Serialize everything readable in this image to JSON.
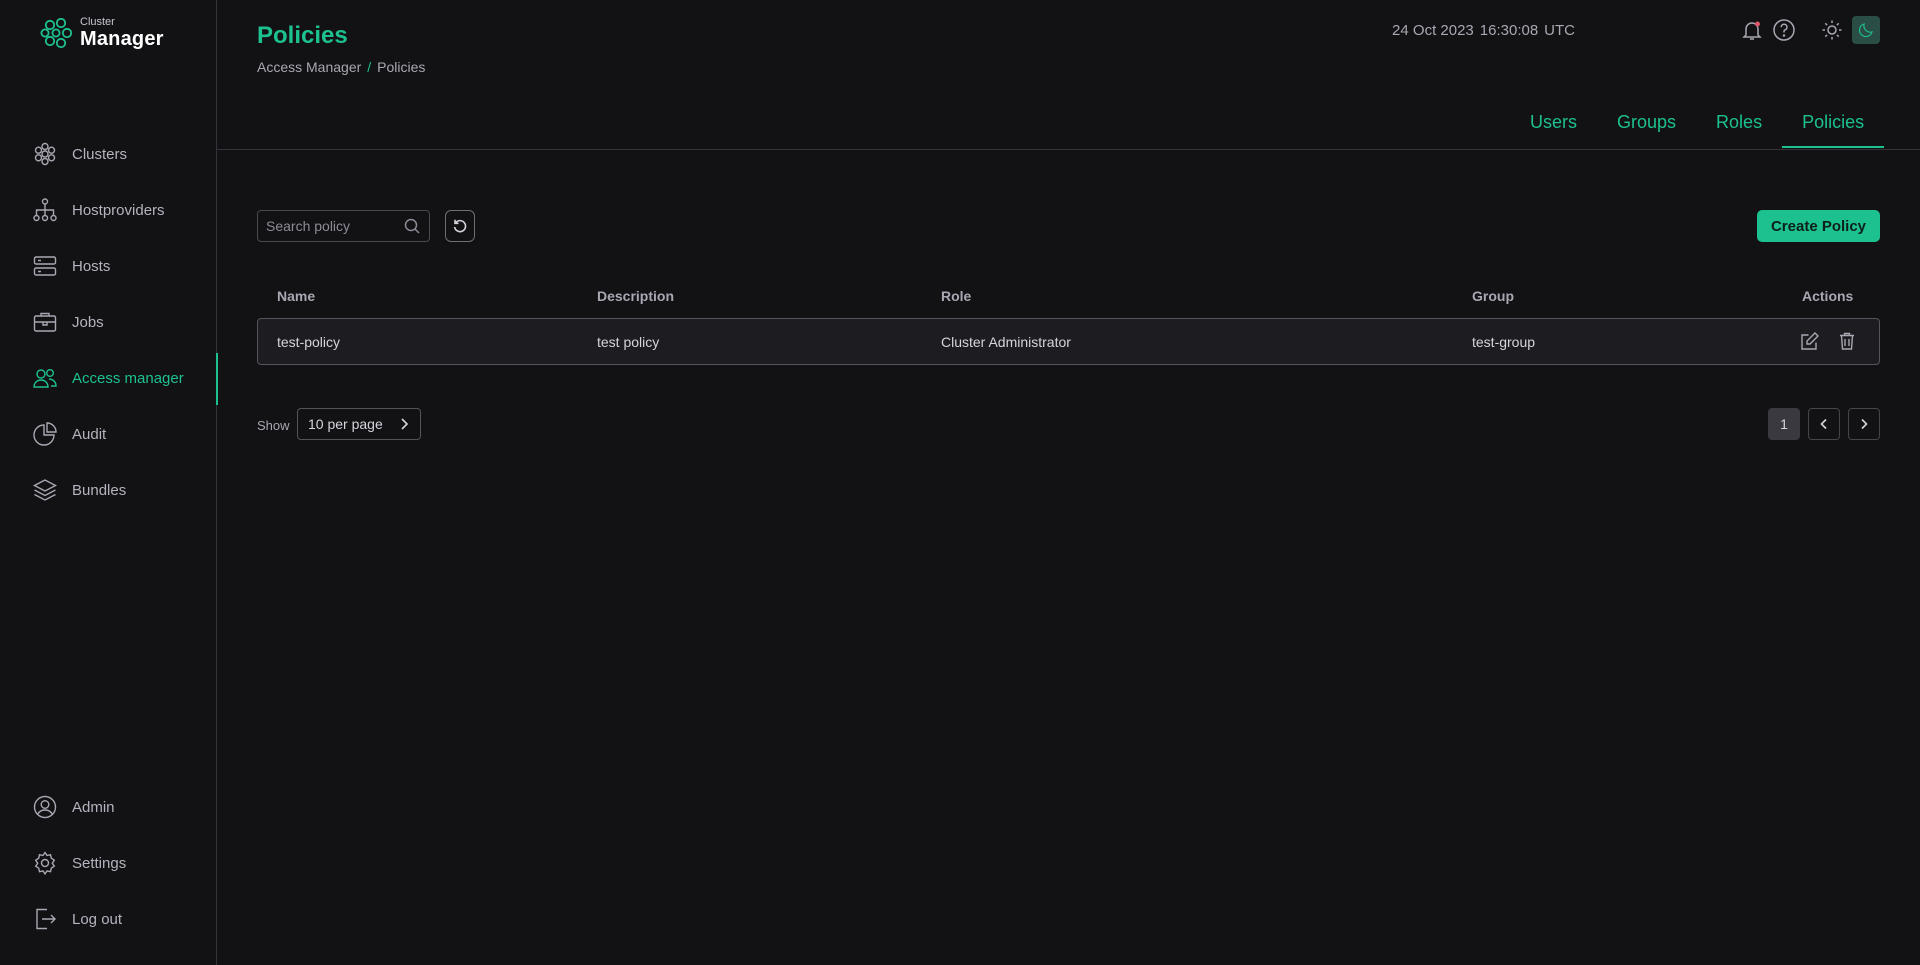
{
  "app": {
    "logo_small": "Cluster",
    "logo_big": "Manager"
  },
  "sidebar": {
    "items": [
      {
        "label": "Clusters"
      },
      {
        "label": "Hostproviders"
      },
      {
        "label": "Hosts"
      },
      {
        "label": "Jobs"
      },
      {
        "label": "Access manager"
      },
      {
        "label": "Audit"
      },
      {
        "label": "Bundles"
      }
    ],
    "bottom": [
      {
        "label": "Admin"
      },
      {
        "label": "Settings"
      },
      {
        "label": "Log out"
      }
    ]
  },
  "header": {
    "title": "Policies",
    "breadcrumb": [
      "Access Manager",
      "/",
      "Policies"
    ],
    "date": "24 Oct 2023",
    "time": "16:30:08",
    "timezone": "UTC"
  },
  "tabs": [
    {
      "label": "Users"
    },
    {
      "label": "Groups"
    },
    {
      "label": "Roles"
    },
    {
      "label": "Policies"
    }
  ],
  "toolbar": {
    "search_placeholder": "Search policy",
    "create_label": "Create Policy"
  },
  "table": {
    "headers": [
      "Name",
      "Description",
      "Role",
      "Group",
      "Actions"
    ],
    "rows": [
      {
        "name": "test-policy",
        "description": "test policy",
        "role": "Cluster Administrator",
        "group": "test-group"
      }
    ]
  },
  "pagination": {
    "show_label": "Show",
    "per_page": "10 per page",
    "current_page": "1"
  },
  "colors": {
    "accent": "#1cc18f",
    "background": "#121114"
  }
}
